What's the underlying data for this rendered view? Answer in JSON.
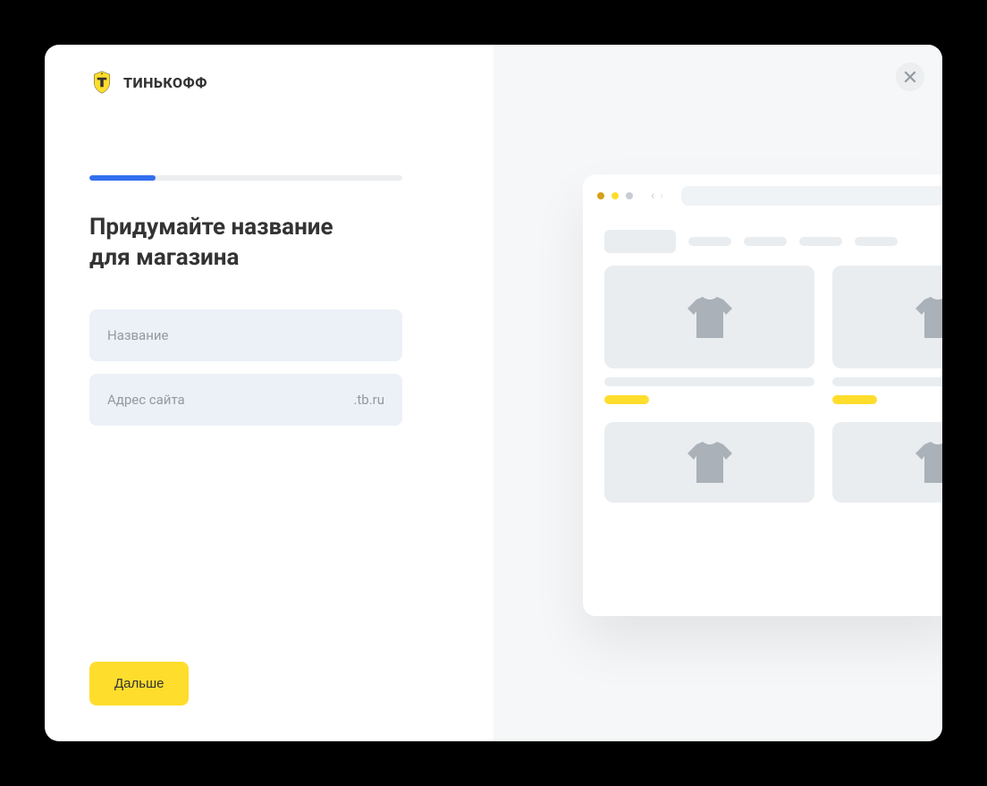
{
  "brand": "ТИНЬКОФФ",
  "progress": {
    "percent": 21
  },
  "heading_line1": "Придумайте название",
  "heading_line2": "для магазина",
  "fields": {
    "name": {
      "label": "Название"
    },
    "site": {
      "label": "Адрес сайта",
      "suffix": ".tb.ru"
    }
  },
  "buttons": {
    "next": "Дальше"
  }
}
